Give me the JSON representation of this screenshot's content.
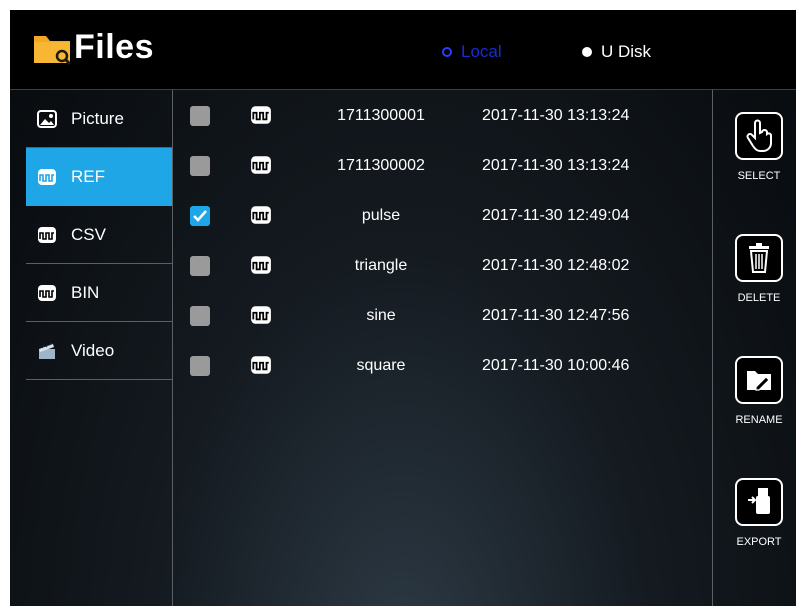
{
  "header": {
    "title": "Files",
    "storage": [
      {
        "label": "Local",
        "selected": true
      },
      {
        "label": "U Disk",
        "selected": false
      }
    ]
  },
  "sidebar": {
    "items": [
      {
        "label": "Picture",
        "icon": "picture-icon",
        "active": false
      },
      {
        "label": "REF",
        "icon": "waveform-icon",
        "active": true
      },
      {
        "label": "CSV",
        "icon": "waveform-icon",
        "active": false
      },
      {
        "label": "BIN",
        "icon": "waveform-icon",
        "active": false
      },
      {
        "label": "Video",
        "icon": "video-icon",
        "active": false
      }
    ]
  },
  "files": [
    {
      "name": "1711300001",
      "date": "2017-11-30 13:13:24",
      "checked": false
    },
    {
      "name": "1711300002",
      "date": "2017-11-30 13:13:24",
      "checked": false
    },
    {
      "name": "pulse",
      "date": "2017-11-30 12:49:04",
      "checked": true
    },
    {
      "name": "triangle",
      "date": "2017-11-30 12:48:02",
      "checked": false
    },
    {
      "name": "sine",
      "date": "2017-11-30 12:47:56",
      "checked": false
    },
    {
      "name": "square",
      "date": "2017-11-30 10:00:46",
      "checked": false
    }
  ],
  "actions": {
    "select": "SELECT",
    "delete": "DELETE",
    "rename": "RENAME",
    "export": "EXPORT"
  },
  "colors": {
    "accent": "#1ea6e6",
    "local_radio": "#1a2bd6",
    "logo": "#f5a623"
  }
}
